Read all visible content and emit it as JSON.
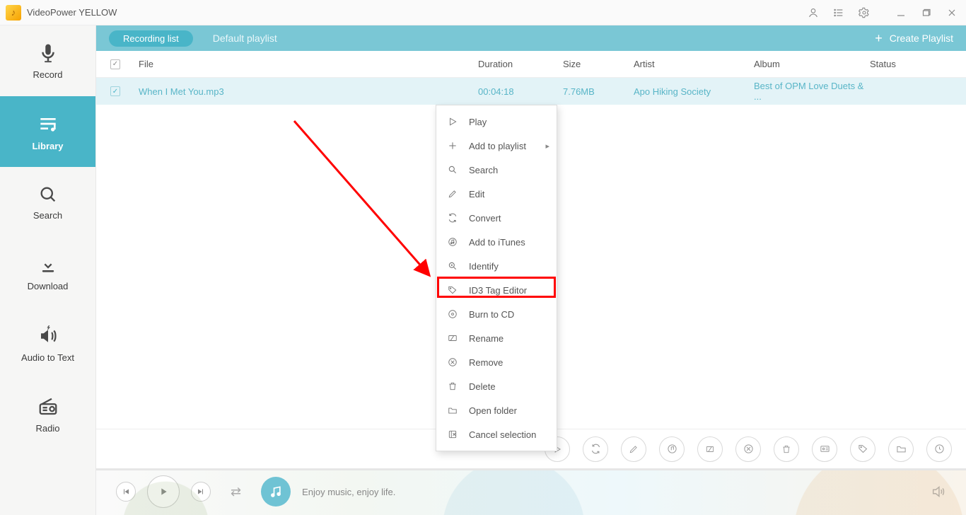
{
  "app": {
    "title": "VideoPower YELLOW"
  },
  "sidebar": {
    "items": [
      {
        "label": "Record"
      },
      {
        "label": "Library"
      },
      {
        "label": "Search"
      },
      {
        "label": "Download"
      },
      {
        "label": "Audio to Text"
      },
      {
        "label": "Radio"
      }
    ]
  },
  "topbar": {
    "tab_active": "Recording list",
    "tab_other": "Default playlist",
    "create": "Create Playlist"
  },
  "columns": {
    "file": "File",
    "duration": "Duration",
    "size": "Size",
    "artist": "Artist",
    "album": "Album",
    "status": "Status"
  },
  "rows": [
    {
      "file": "When I Met You.mp3",
      "duration": "00:04:18",
      "size": "7.76MB",
      "artist": "Apo Hiking Society",
      "album": "Best of OPM Love Duets & ...",
      "status": ""
    }
  ],
  "context": {
    "play": "Play",
    "add_to_playlist": "Add to playlist",
    "search": "Search",
    "edit": "Edit",
    "convert": "Convert",
    "add_to_itunes": "Add to iTunes",
    "identify": "Identify",
    "id3": "ID3 Tag Editor",
    "burn": "Burn to CD",
    "rename": "Rename",
    "remove": "Remove",
    "delete": "Delete",
    "open_folder": "Open folder",
    "cancel_sel": "Cancel selection"
  },
  "player": {
    "hint": "Enjoy music, enjoy life."
  }
}
